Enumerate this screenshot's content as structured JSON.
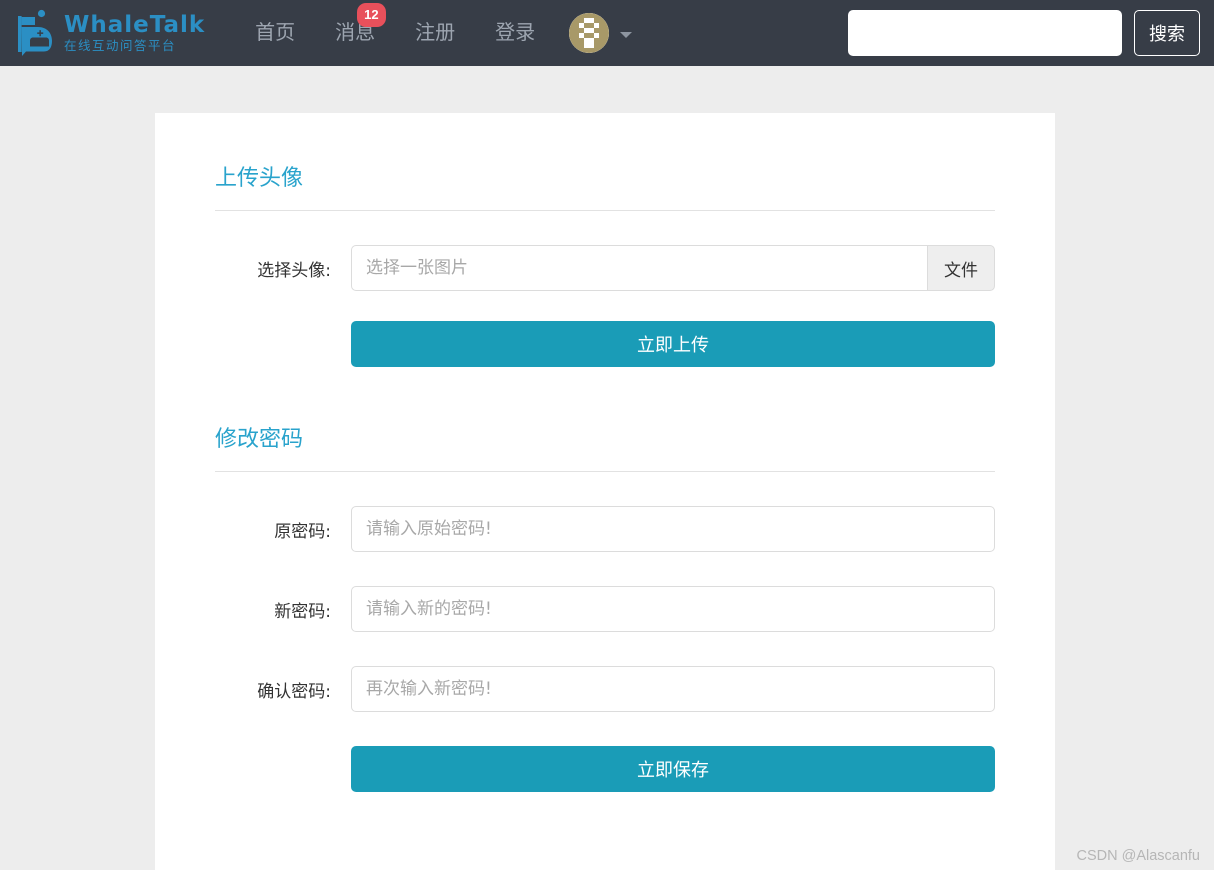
{
  "navbar": {
    "brand": {
      "title": "WhaleTalk",
      "subtitle": "在线互动问答平台",
      "icon": "whale-icon"
    },
    "menu": [
      {
        "label": "首页",
        "badge": null
      },
      {
        "label": "消息",
        "badge": "12"
      },
      {
        "label": "注册",
        "badge": null
      },
      {
        "label": "登录",
        "badge": null
      }
    ],
    "avatar": {
      "icon": "user-avatar-identicon",
      "caret_icon": "chevron-down-icon"
    },
    "search": {
      "value": "",
      "placeholder": "",
      "button_label": "搜索"
    }
  },
  "content": {
    "upload_section": {
      "heading": "上传头像",
      "file_row": {
        "label": "选择头像:",
        "placeholder": "选择一张图片",
        "value": "",
        "addon_label": "文件"
      },
      "submit_label": "立即上传"
    },
    "password_section": {
      "heading": "修改密码",
      "fields": [
        {
          "label": "原密码:",
          "placeholder": "请输入原始密码!",
          "value": ""
        },
        {
          "label": "新密码:",
          "placeholder": "请输入新的密码!",
          "value": ""
        },
        {
          "label": "确认密码:",
          "placeholder": "再次输入新密码!",
          "value": ""
        }
      ],
      "submit_label": "立即保存"
    }
  },
  "watermark": "CSDN @Alascanfu",
  "colors": {
    "navbar_bg": "#373d47",
    "page_bg": "#ededed",
    "panel_bg": "#ffffff",
    "brand_blue": "#2b8fc4",
    "heading_blue": "#29a3cc",
    "primary_button": "#1a9cb7",
    "badge_red": "#e8505b",
    "nav_link": "#9da5b0",
    "avatar_tan": "#a89968"
  }
}
